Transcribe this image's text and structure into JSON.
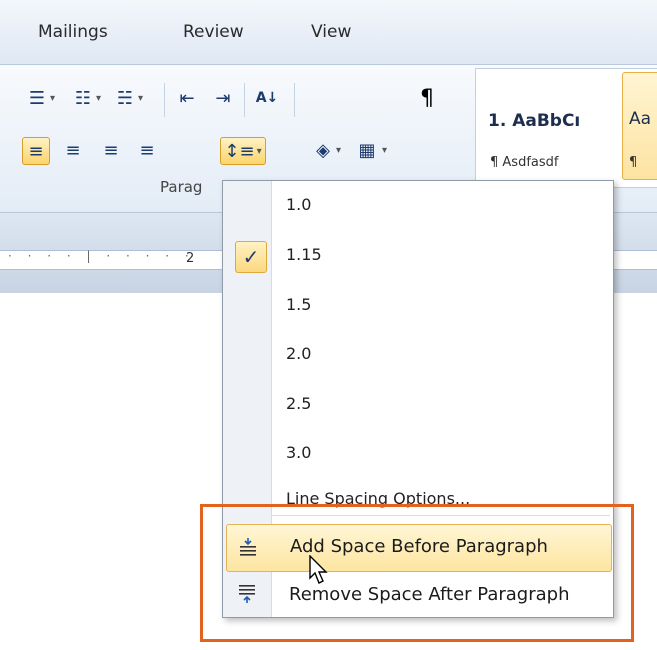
{
  "tabs": [
    "Mailings",
    "Review",
    "View"
  ],
  "ribbon": {
    "group_label": "Parag",
    "styles": [
      {
        "label": "1. AaBbCı",
        "sub": "¶ Asdfasdf"
      },
      {
        "label": "Aa",
        "sub": "¶"
      }
    ]
  },
  "ruler": {
    "number": "2"
  },
  "menu": {
    "items": [
      "1.0",
      "1.15",
      "1.5",
      "2.0",
      "2.5",
      "3.0"
    ],
    "checked": "1.15",
    "check_glyph": "✓",
    "options": "Line Spacing Options...",
    "add_before": "Add Space Before Paragraph",
    "remove_after": "Remove Space After Paragraph"
  },
  "colors": {
    "highlight_frame": "#e2631d",
    "hover": "#fde5a1"
  }
}
